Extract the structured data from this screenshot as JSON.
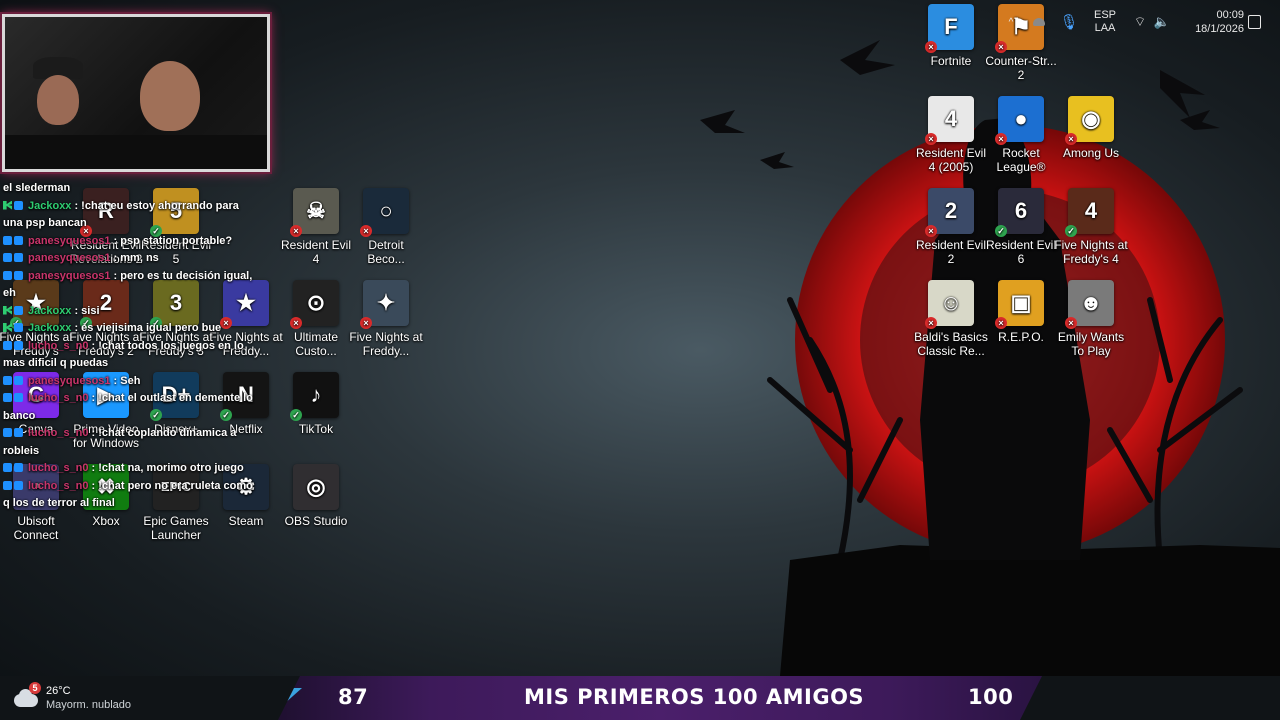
{
  "desktop_icons": [
    {
      "label": "Fortnite",
      "color": "#2b8de0",
      "glyph": "F",
      "badge": "err"
    },
    {
      "label": "Counter-Str... 2",
      "color": "#d47a1f",
      "glyph": "⚑",
      "badge": "err"
    },
    {
      "label": "Resident Evil 4 (2005)",
      "color": "#e8e8e8",
      "glyph": "4",
      "badge": "err"
    },
    {
      "label": "Rocket League®",
      "color": "#1c6fd1",
      "glyph": "●",
      "badge": "err"
    },
    {
      "label": "Among Us",
      "color": "#e8c020",
      "glyph": "◉",
      "badge": "err"
    },
    {
      "label": "Resident Evil 2",
      "color": "#3b4a68",
      "glyph": "2",
      "badge": "err"
    },
    {
      "label": "Resident Evil 6",
      "color": "#2a2a3a",
      "glyph": "6",
      "badge": "ok"
    },
    {
      "label": "Five Nights at Freddy's 4",
      "color": "#5a2a1a",
      "glyph": "4",
      "badge": "ok"
    },
    {
      "label": "Baldi's Basics Classic Re...",
      "color": "#d8d8c8",
      "glyph": "☺",
      "badge": "err"
    },
    {
      "label": "R.E.P.O.",
      "color": "#e0a020",
      "glyph": "▣",
      "badge": "err"
    },
    {
      "label": "Emily Wants To Play",
      "color": "#7a7a7a",
      "glyph": "☻",
      "badge": "err"
    },
    {
      "label": "Resident Evil 4",
      "color": "#5a5a50",
      "glyph": "☠",
      "badge": "err"
    },
    {
      "label": "Detroit Beco...",
      "color": "#1a2a3a",
      "glyph": "○",
      "badge": "err"
    },
    {
      "label": "Five Nights at Freddy...",
      "color": "#3a3aa0",
      "glyph": "★",
      "badge": "err"
    },
    {
      "label": "Ultimate Custo...",
      "color": "#222222",
      "glyph": "⊙",
      "badge": "err"
    },
    {
      "label": "Five Nights at Freddy...",
      "color": "#3a4a5a",
      "glyph": "✦",
      "badge": "err"
    },
    {
      "label": "Netflix",
      "color": "#141414",
      "glyph": "N",
      "badge": "ok"
    },
    {
      "label": "TikTok",
      "color": "#111111",
      "glyph": "♪",
      "badge": "ok"
    },
    {
      "label": "Disney+",
      "color": "#113b5c",
      "glyph": "D+",
      "badge": "ok"
    },
    {
      "label": "Prime Video for Windows",
      "color": "#1a98ff",
      "glyph": "▶",
      "badge": ""
    },
    {
      "label": "Canva",
      "color": "#7d2ae8",
      "glyph": "C",
      "badge": ""
    },
    {
      "label": "Ubisoft Connect",
      "color": "#3a3a6a",
      "glyph": "◔",
      "badge": ""
    },
    {
      "label": "Xbox",
      "color": "#107c10",
      "glyph": "✖",
      "badge": ""
    },
    {
      "label": "Epic Games Launcher",
      "color": "#222222",
      "glyph": "EPIC",
      "badge": ""
    },
    {
      "label": "Steam",
      "color": "#1b2838",
      "glyph": "⚙",
      "badge": ""
    },
    {
      "label": "OBS Studio",
      "color": "#302e31",
      "glyph": "◎",
      "badge": ""
    },
    {
      "label": "Resident Evil Revelations 2",
      "color": "#3a2020",
      "glyph": "R",
      "badge": "err"
    },
    {
      "label": "Resident Evil 5",
      "color": "#c09020",
      "glyph": "5",
      "badge": "ok"
    },
    {
      "label": "Five Nights at Freddy's",
      "color": "#5a3a1a",
      "glyph": "★",
      "badge": "ok"
    },
    {
      "label": "Five Nights at Freddy's 2",
      "color": "#6a2a1a",
      "glyph": "2",
      "badge": "ok"
    },
    {
      "label": "Five Nights at Freddy's 3",
      "color": "#6a6a20",
      "glyph": "3",
      "badge": "ok"
    }
  ],
  "chat": [
    {
      "user": "",
      "msg": "el slederman",
      "color": "#ffffff",
      "bdg": ""
    },
    {
      "user": "Jackoxx",
      "msg": ": !chat eu estoy ahorrando para una psp bancan",
      "color": "#2ecc71",
      "bdg": "g"
    },
    {
      "user": "panesyquesos1",
      "msg": ": psp station portable?",
      "color": "#c9356b",
      "bdg": "b"
    },
    {
      "user": "panesyquesos1",
      "msg": ": mm, ns",
      "color": "#c9356b",
      "bdg": "b"
    },
    {
      "user": "panesyquesos1",
      "msg": ": pero es tu decisión igual, eh",
      "color": "#c9356b",
      "bdg": "b"
    },
    {
      "user": "Jackoxx",
      "msg": ": sisi",
      "color": "#2ecc71",
      "bdg": "g"
    },
    {
      "user": "Jackoxx",
      "msg": ": es viejisima igual pero bue",
      "color": "#2ecc71",
      "bdg": "g"
    },
    {
      "user": "lucho_s_n0",
      "msg": ": !chat todos los juegos en lo mas dificil q puedas",
      "color": "#c9356b",
      "bdg": "b"
    },
    {
      "user": "panesyquesos1",
      "msg": ": Seh",
      "color": "#c9356b",
      "bdg": "b"
    },
    {
      "user": "lucho_s_n0",
      "msg": ": !chat el outlast en demente lo banco",
      "color": "#c9356b",
      "bdg": "b"
    },
    {
      "user": "lucho_s_n0",
      "msg": ": !chat coplando dinamica a robleis",
      "color": "#c9356b",
      "bdg": "b"
    },
    {
      "user": "lucho_s_n0",
      "msg": ": !chat na, morimo otro juego",
      "color": "#c9356b",
      "bdg": "b"
    },
    {
      "user": "lucho_s_n0",
      "msg": ": !chat pero no era ruleta como q los de terror al final",
      "color": "#c9356b",
      "bdg": "b"
    }
  ],
  "taskbar": {
    "weather_temp": "26°C",
    "weather_desc": "Mayorm. nublado",
    "weather_badge": "5",
    "banner_left": "87",
    "banner_title": "MIS PRIMEROS 100 AMIGOS",
    "banner_right": "100",
    "lang_1": "ESP",
    "lang_2": "LAA",
    "time": "00:09",
    "date": "18/1/2026"
  }
}
